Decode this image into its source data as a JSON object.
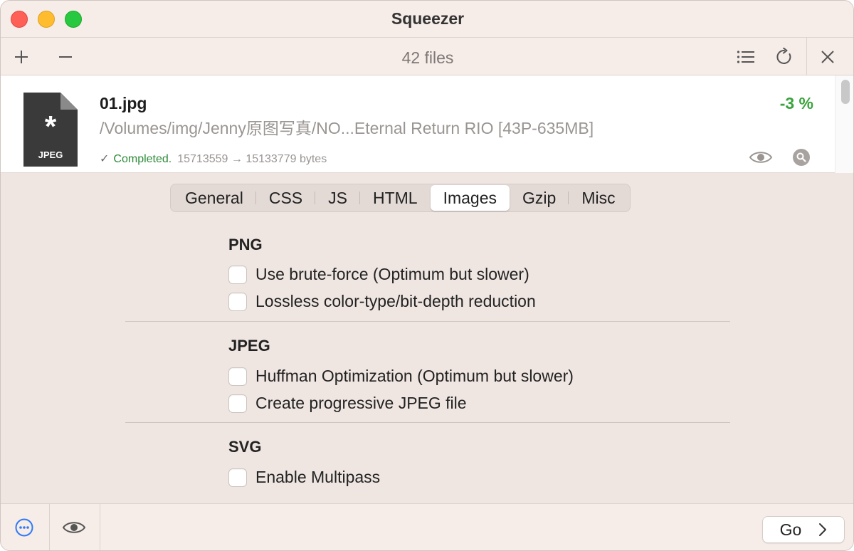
{
  "window": {
    "title": "Squeezer"
  },
  "toolbar": {
    "file_count": "42 files"
  },
  "file": {
    "icon_label": "JPEG",
    "name": "01.jpg",
    "path": "/Volumes/img/Jenny原图写真/NO...Eternal Return RIO [43P-635MB]",
    "status_check": "✓",
    "status": "Completed.",
    "bytes": "15713559 → 15133779 bytes",
    "percent": "-3 %"
  },
  "tabs": [
    {
      "label": "General"
    },
    {
      "label": "CSS"
    },
    {
      "label": "JS"
    },
    {
      "label": "HTML"
    },
    {
      "label": "Images",
      "active": true
    },
    {
      "label": "Gzip"
    },
    {
      "label": "Misc"
    }
  ],
  "sections": {
    "png": {
      "title": "PNG",
      "options": [
        {
          "label": "Use brute-force (Optimum but slower)",
          "checked": false
        },
        {
          "label": "Lossless color-type/bit-depth reduction",
          "checked": false
        }
      ]
    },
    "jpeg": {
      "title": "JPEG",
      "options": [
        {
          "label": "Huffman Optimization (Optimum but slower)",
          "checked": false
        },
        {
          "label": "Create progressive JPEG file",
          "checked": false
        }
      ]
    },
    "svg": {
      "title": "SVG",
      "options": [
        {
          "label": "Enable Multipass",
          "checked": false
        }
      ]
    }
  },
  "bottom": {
    "go_label": "Go"
  },
  "colors": {
    "accent_blue": "#2f7bf5",
    "success_green": "#3aa33d",
    "window_bg": "#efe6e2"
  }
}
